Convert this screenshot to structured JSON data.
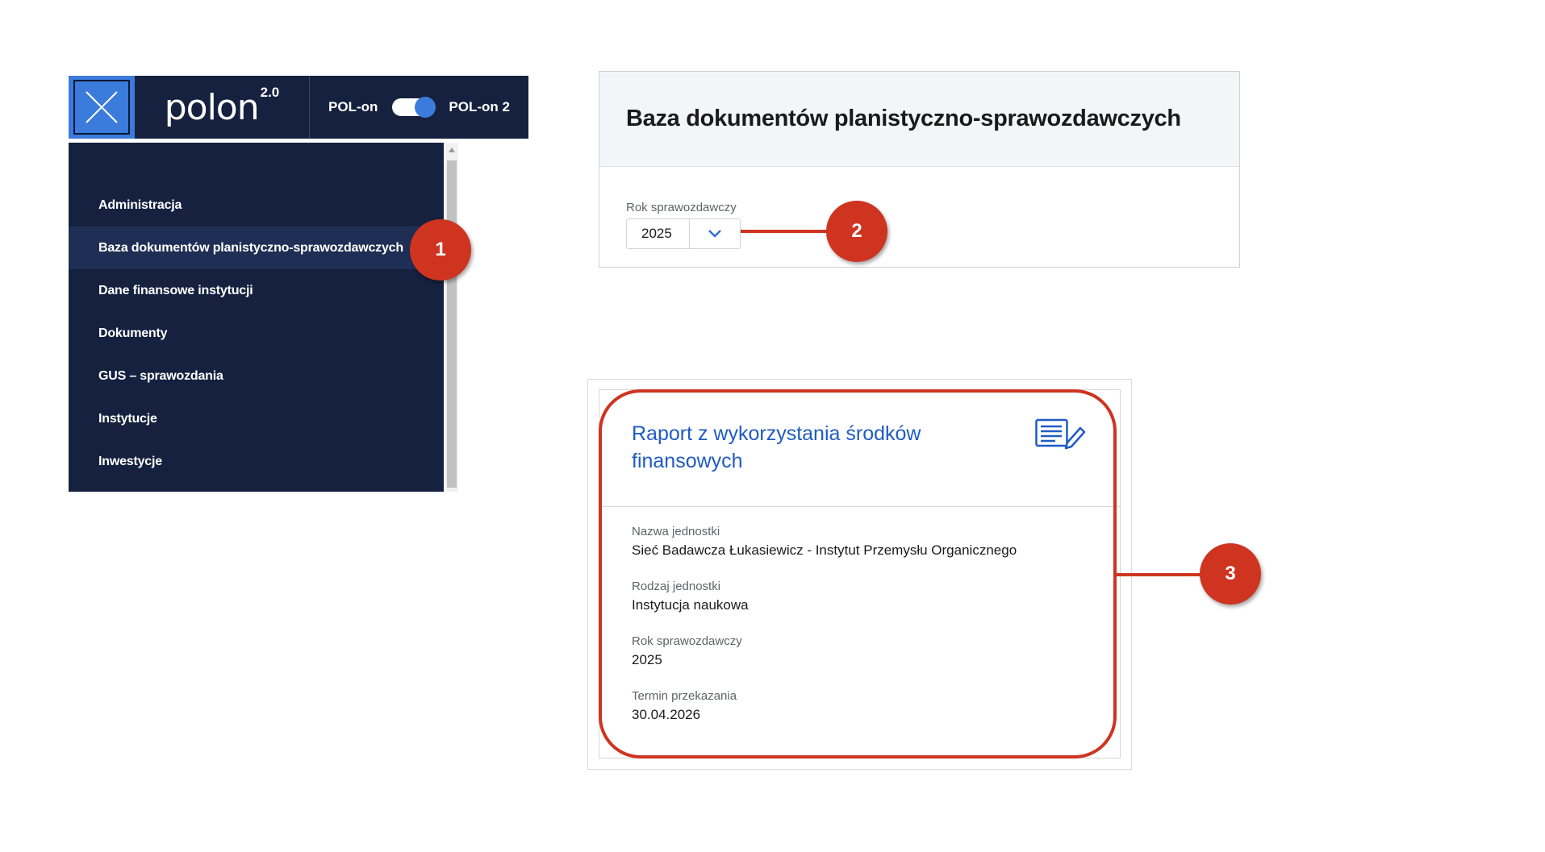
{
  "topbar": {
    "menu_icon": "close-icon",
    "logo_text": "polon",
    "logo_version": "2.0",
    "switch_left_label": "POL-on",
    "switch_right_label": "POL-on 2",
    "switch_on": true
  },
  "sidebar": {
    "items": [
      {
        "label": "Administracja"
      },
      {
        "label": "Baza dokumentów planistyczno-sprawozdawczych"
      },
      {
        "label": "Dane finansowe instytucji"
      },
      {
        "label": "Dokumenty"
      },
      {
        "label": "GUS – sprawozdania"
      },
      {
        "label": "Instytucje"
      },
      {
        "label": "Inwestycje"
      }
    ],
    "active_index": 1
  },
  "panel": {
    "title": "Baza dokumentów planistyczno-sprawozdawczych",
    "year_label": "Rok sprawozdawczy",
    "year_value": "2025"
  },
  "card": {
    "title": "Raport z wykorzystania środków finansowych",
    "icon": "document-edit-icon",
    "fields": [
      {
        "label": "Nazwa jednostki",
        "value": "Sieć Badawcza Łukasiewicz - Instytut Przemysłu Organicznego"
      },
      {
        "label": "Rodzaj jednostki",
        "value": "Instytucja naukowa"
      },
      {
        "label": "Rok sprawozdawczy",
        "value": "2025"
      },
      {
        "label": "Termin przekazania",
        "value": "30.04.2026"
      }
    ]
  },
  "badges": [
    "1",
    "2",
    "3"
  ],
  "colors": {
    "navy": "#15213f",
    "accent_blue": "#3b7bdb",
    "badge_red": "#cf3420",
    "link_blue": "#1f5bc4"
  }
}
